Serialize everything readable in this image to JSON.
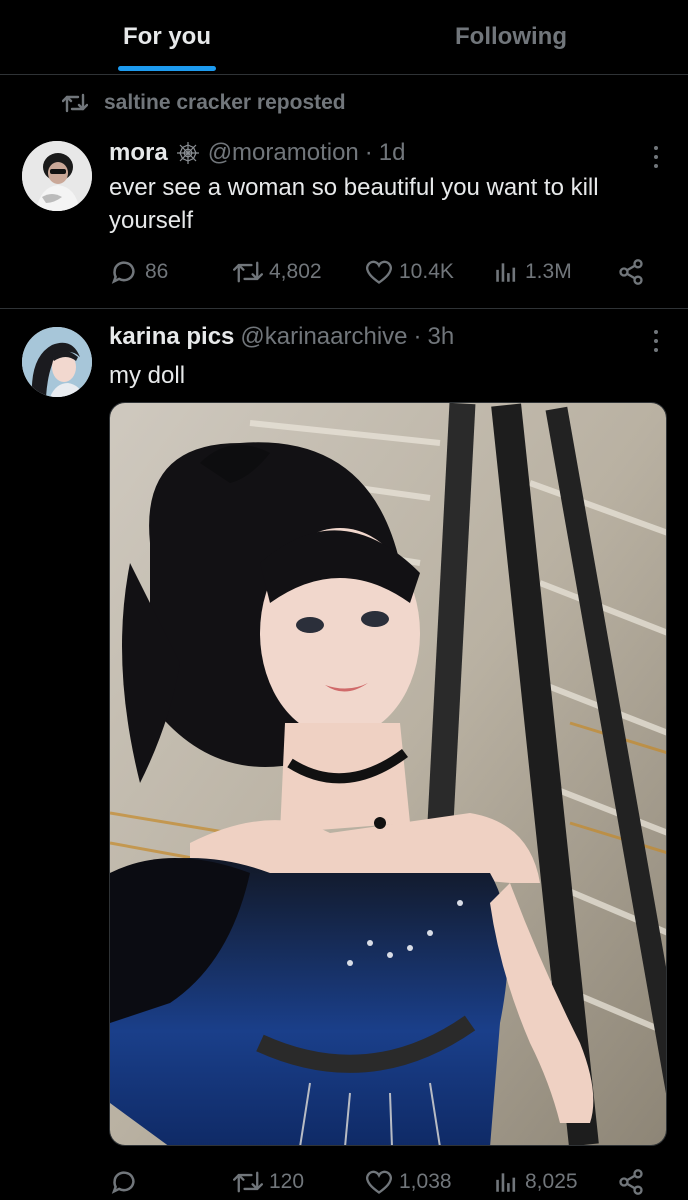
{
  "tabs": [
    {
      "label": "For you",
      "active": true
    },
    {
      "label": "Following",
      "active": false
    }
  ],
  "accent_color": "#1d9bf0",
  "posts": [
    {
      "repost": {
        "icon": "repost-icon",
        "text": "saltine cracker reposted"
      },
      "author": {
        "name": "mora",
        "badge_icon": "spiderweb-icon",
        "handle": "@moramotion",
        "dot": "·",
        "time": "1d"
      },
      "text": "ever see a woman so beautiful you want to kill yourself",
      "stats": {
        "replies": "86",
        "reposts": "4,802",
        "likes": "10.4K",
        "views": "1.3M"
      }
    },
    {
      "author": {
        "name": "karina pics",
        "handle": "@karinaarchive",
        "dot": "·",
        "time": "3h"
      },
      "text": "my doll",
      "media": {
        "type": "photo",
        "description_icon": "photo-image"
      },
      "stats": {
        "replies": "",
        "reposts": "120",
        "likes": "1,038",
        "views": "8,025"
      }
    }
  ]
}
